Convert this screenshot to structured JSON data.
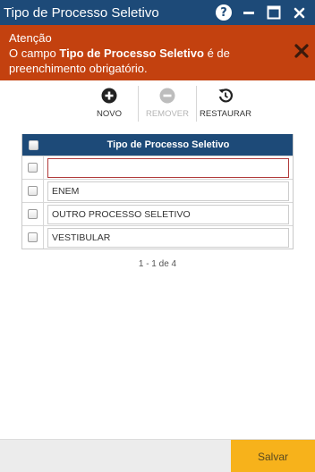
{
  "window": {
    "title": "Tipo de Processo Seletivo"
  },
  "alert": {
    "heading": "Atenção",
    "message_prefix": "O campo ",
    "message_field": "Tipo de Processo Seletivo",
    "message_suffix": " é de",
    "message_line2": "preenchimento obrigatório.",
    "background": "#c3410f"
  },
  "toolbar": {
    "new_label": "NOVO",
    "remove_label": "REMOVER",
    "restore_label": "RESTAURAR"
  },
  "grid": {
    "header": "Tipo de Processo Seletivo",
    "rows": [
      {
        "value": ""
      },
      {
        "value": "ENEM"
      },
      {
        "value": "OUTRO PROCESSO SELETIVO"
      },
      {
        "value": "VESTIBULAR"
      }
    ],
    "pager": "1 - 1 de 4"
  },
  "footer": {
    "save_label": "Salvar"
  },
  "colors": {
    "primary": "#1d4a78",
    "accent": "#f7b21b",
    "error": "#c3410f"
  },
  "icons": [
    "help-icon",
    "minimize-icon",
    "maximize-icon",
    "close-icon",
    "plus-circle-icon",
    "minus-circle-icon",
    "restore-icon",
    "checkbox-icon"
  ]
}
